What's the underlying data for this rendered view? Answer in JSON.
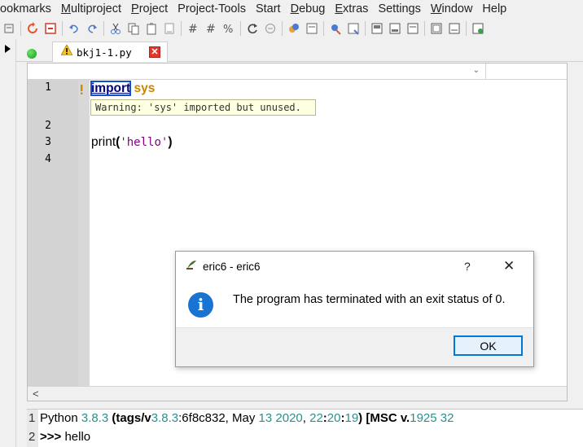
{
  "menubar": {
    "items": [
      {
        "label": "ookmarks",
        "u": ""
      },
      {
        "label": "Multiproject",
        "u": "M"
      },
      {
        "label": "Project",
        "u": "P"
      },
      {
        "label": "Project-Tools",
        "u": ""
      },
      {
        "label": "Start",
        "u": ""
      },
      {
        "label": "Debug",
        "u": "D"
      },
      {
        "label": "Extras",
        "u": "E"
      },
      {
        "label": "Settings",
        "u": ""
      },
      {
        "label": "Window",
        "u": "W"
      },
      {
        "label": "Help",
        "u": ""
      }
    ]
  },
  "tab": {
    "filename": "bkj1-1.py",
    "close_glyph": "✕"
  },
  "editor": {
    "line_numbers": [
      "1",
      "2",
      "3",
      "4"
    ],
    "line1": {
      "keyword": "import",
      "module": "sys"
    },
    "annotation": "Warning: 'sys' imported but unused.",
    "line3": {
      "func": "print",
      "open": "(",
      "string": "'hello'",
      "close": ")"
    },
    "scroll_left_glyph": "<",
    "combo_arrow": "⌄"
  },
  "shell": {
    "line1": {
      "no": "1",
      "parts": [
        "Python ",
        "3.8.3",
        " (tags/v",
        "3.8.3",
        ":6f8c832, May ",
        "13",
        " ",
        "2020",
        ", ",
        "22",
        ":",
        "20",
        ":",
        "19",
        ") [MSC v.",
        "1925",
        " ",
        "32"
      ]
    },
    "line2": {
      "no": "2",
      "prompt": ">>>",
      "output": "hello"
    }
  },
  "dialog": {
    "title": "eric6 - eric6",
    "help_glyph": "?",
    "close_glyph": "✕",
    "info_glyph": "i",
    "message": "The program has terminated with an exit status of 0.",
    "ok_label": "OK"
  },
  "colors": {
    "keyword": "#00007f",
    "module": "#c98600",
    "string": "#7f007f",
    "number": "#2a8f8f",
    "info_blue": "#1874d2",
    "ok_border": "#0078d7"
  }
}
